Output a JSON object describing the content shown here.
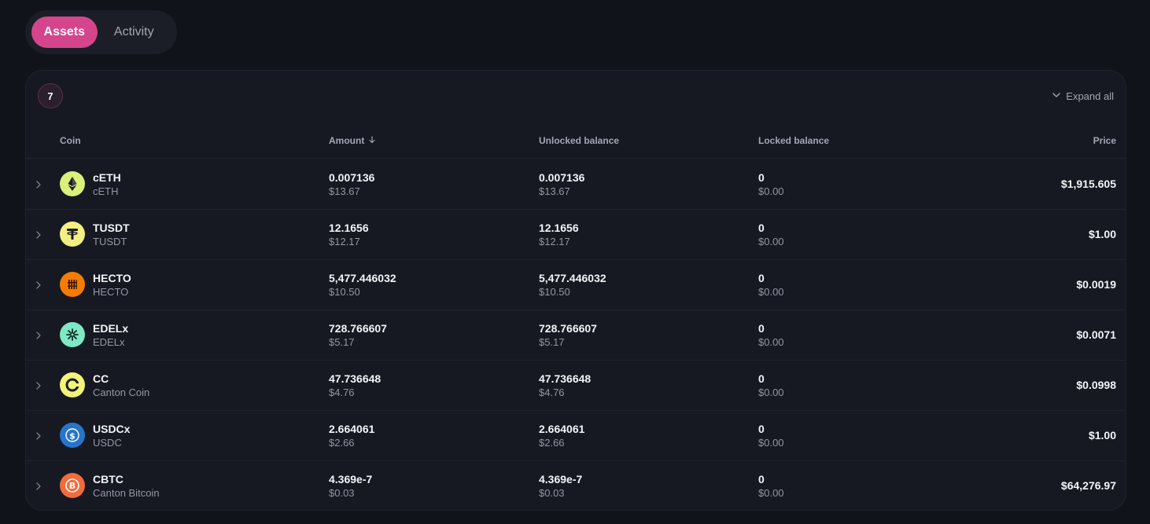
{
  "tabs": [
    {
      "label": "Assets",
      "active": true
    },
    {
      "label": "Activity",
      "active": false
    }
  ],
  "panel": {
    "count": "7",
    "expand_all_label": "Expand all"
  },
  "table": {
    "headers": {
      "coin": "Coin",
      "amount": "Amount",
      "unlocked": "Unlocked balance",
      "locked": "Locked balance",
      "price": "Price"
    },
    "rows": [
      {
        "symbol": "cETH",
        "name": "cETH",
        "icon": "ethereum-icon",
        "icon_bg": "#d9f07a",
        "amount": "0.007136",
        "amount_usd": "$13.67",
        "unlocked": "0.007136",
        "unlocked_usd": "$13.67",
        "locked": "0",
        "locked_usd": "$0.00",
        "price": "$1,915.605"
      },
      {
        "symbol": "TUSDT",
        "name": "TUSDT",
        "icon": "tether-icon",
        "icon_bg": "#f3ef83",
        "amount": "12.1656",
        "amount_usd": "$12.17",
        "unlocked": "12.1656",
        "unlocked_usd": "$12.17",
        "locked": "0",
        "locked_usd": "$0.00",
        "price": "$1.00"
      },
      {
        "symbol": "HECTO",
        "name": "HECTO",
        "icon": "hecto-icon",
        "icon_bg": "#f57c00",
        "amount": "5,477.446032",
        "amount_usd": "$10.50",
        "unlocked": "5,477.446032",
        "unlocked_usd": "$10.50",
        "locked": "0",
        "locked_usd": "$0.00",
        "price": "$0.0019"
      },
      {
        "symbol": "EDELx",
        "name": "EDELx",
        "icon": "edel-icon",
        "icon_bg": "#7fe8c5",
        "amount": "728.766607",
        "amount_usd": "$5.17",
        "unlocked": "728.766607",
        "unlocked_usd": "$5.17",
        "locked": "0",
        "locked_usd": "$0.00",
        "price": "$0.0071"
      },
      {
        "symbol": "CC",
        "name": "Canton Coin",
        "icon": "canton-coin-icon",
        "icon_bg": "#f3f37a",
        "amount": "47.736648",
        "amount_usd": "$4.76",
        "unlocked": "47.736648",
        "unlocked_usd": "$4.76",
        "locked": "0",
        "locked_usd": "$0.00",
        "price": "$0.0998"
      },
      {
        "symbol": "USDCx",
        "name": "USDC",
        "icon": "usdc-icon",
        "icon_bg": "#2775ca",
        "amount": "2.664061",
        "amount_usd": "$2.66",
        "unlocked": "2.664061",
        "unlocked_usd": "$2.66",
        "locked": "0",
        "locked_usd": "$0.00",
        "price": "$1.00"
      },
      {
        "symbol": "CBTC",
        "name": "Canton Bitcoin",
        "icon": "canton-bitcoin-icon",
        "icon_bg": "#f26b3a",
        "amount": "4.369e-7",
        "amount_usd": "$0.03",
        "unlocked": "4.369e-7",
        "unlocked_usd": "$0.03",
        "locked": "0",
        "locked_usd": "$0.00",
        "price": "$64,276.97"
      }
    ]
  },
  "colors": {
    "accent": "#d4458c",
    "background": "#11131a",
    "panel": "#161922"
  }
}
